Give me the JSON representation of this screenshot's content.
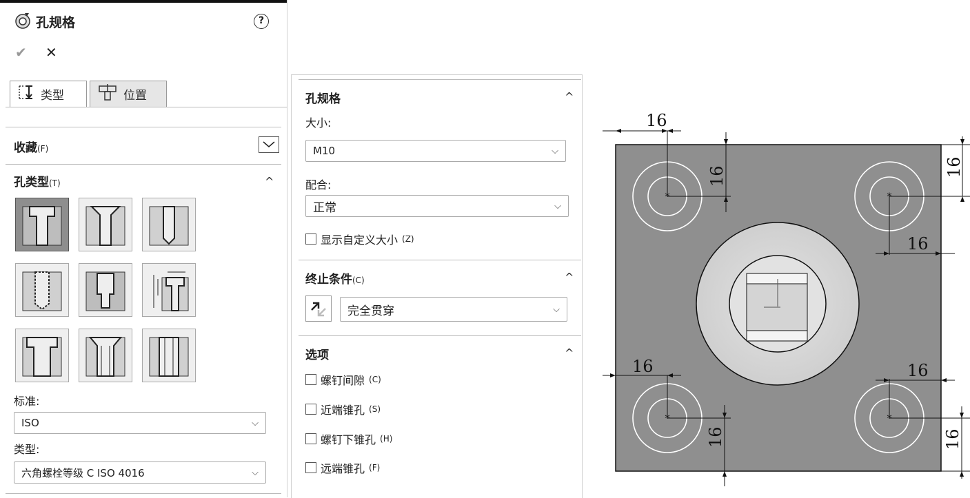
{
  "left_panel": {
    "title": "孔规格",
    "help_icon": "?",
    "confirm_icon": "✔",
    "cancel_icon": "✕",
    "tabs": [
      {
        "label": "类型",
        "active": true
      },
      {
        "label": "位置",
        "active": false
      }
    ],
    "favorites": {
      "label": "收藏",
      "shortcut": "(F)"
    },
    "hole_type": {
      "label": "孔类型",
      "shortcut": "(T)",
      "collapse": "^"
    },
    "standard": {
      "label": "标准:",
      "value": "ISO"
    },
    "type": {
      "label": "类型:",
      "value": "六角螺栓等级 C ISO 4016"
    }
  },
  "middle_panel": {
    "hole_spec": {
      "title": "孔规格",
      "size_label": "大小:",
      "size_value": "M10",
      "fit_label": "配合:",
      "fit_value": "正常",
      "custom_size_label": "显示自定义大小",
      "custom_size_shortcut": "(Z)"
    },
    "end_condition": {
      "title": "终止条件",
      "shortcut": "(C)",
      "value": "完全贯穿"
    },
    "options": {
      "title": "选项",
      "items": [
        {
          "label": "螺钉间隙",
          "shortcut": "(C)"
        },
        {
          "label": "近端锥孔",
          "shortcut": "(S)"
        },
        {
          "label": "螺钉下锥孔",
          "shortcut": "(H)"
        },
        {
          "label": "远端锥孔",
          "shortcut": "(F)"
        }
      ]
    }
  },
  "drawing": {
    "dimensions": [
      "16",
      "16",
      "16",
      "16",
      "16",
      "16",
      "16",
      "16"
    ],
    "colors": {
      "plate": "#8f8f8f",
      "boss": "#d9d9d9",
      "hole": "#ffffff"
    }
  }
}
